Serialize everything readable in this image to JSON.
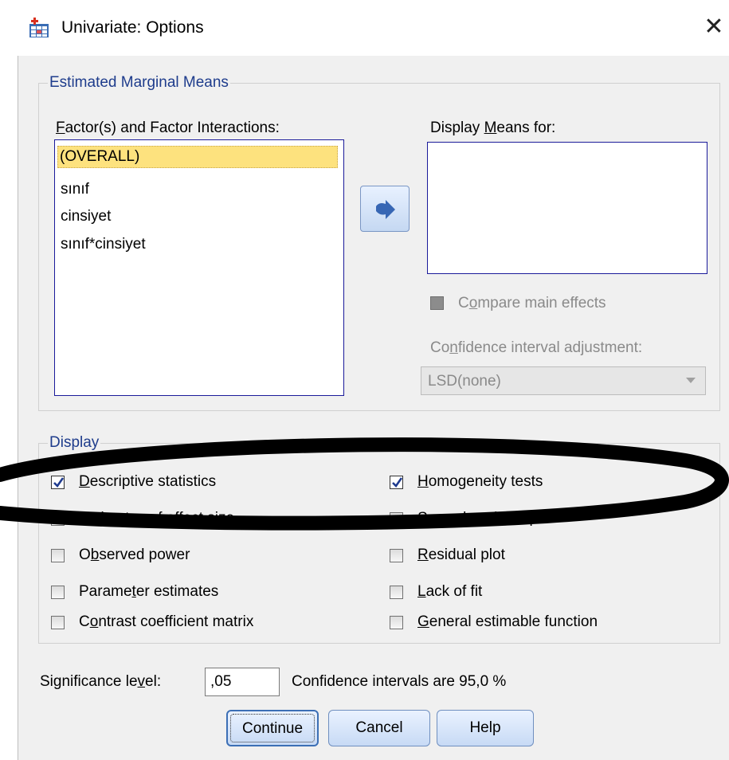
{
  "window": {
    "title": "Univariate: Options",
    "close_glyph": "✕"
  },
  "emm": {
    "legend": "Estimated Marginal Means",
    "factors_label_u": "F",
    "factors_label_rest": "actor(s) and Factor Interactions:",
    "factors": [
      "(OVERALL)",
      "sınıf",
      "cinsiyet",
      "sınıf*cinsiyet"
    ],
    "display_means_pre": "Display ",
    "display_means_u": "M",
    "display_means_post": "eans for:",
    "compare_pre": "C",
    "compare_u": "o",
    "compare_post": "mpare main effects",
    "ci_adj_pre": "Co",
    "ci_adj_u": "n",
    "ci_adj_post": "fidence interval adjustment:",
    "ci_adj_value": "LSD(none)"
  },
  "display": {
    "legend": "Display",
    "options": {
      "descriptive": {
        "u": "D",
        "rest": "escriptive statistics",
        "checked": true
      },
      "homogeneity": {
        "u": "H",
        "rest": "omogeneity tests",
        "checked": true
      },
      "effect_size": {
        "u": "E",
        "rest": "stimates of effect size",
        "checked": false
      },
      "spread": {
        "u": "S",
        "rest": "pread vs. level plot",
        "checked": false
      },
      "observed_power": {
        "pre": "O",
        "u": "b",
        "rest": "served power",
        "checked": false
      },
      "residual": {
        "u": "R",
        "rest": "esidual plot",
        "checked": false
      },
      "parameter": {
        "pre": "Parame",
        "u": "t",
        "rest": "er estimates",
        "checked": false
      },
      "lack_of_fit": {
        "u": "L",
        "rest": "ack of fit",
        "checked": false
      },
      "contrast": {
        "pre": "C",
        "u": "o",
        "rest": "ntrast coefficient matrix",
        "checked": false
      },
      "general": {
        "u": "G",
        "rest": "eneral estimable function",
        "checked": false
      }
    }
  },
  "significance": {
    "label_pre": "Significance le",
    "label_u": "v",
    "label_post": "el:",
    "value": ",05",
    "ci_text": "Confidence intervals are 95,0 %"
  },
  "buttons": {
    "continue": "Continue",
    "cancel": "Cancel",
    "help": "Help"
  },
  "annotation": {
    "color": "#000000"
  }
}
